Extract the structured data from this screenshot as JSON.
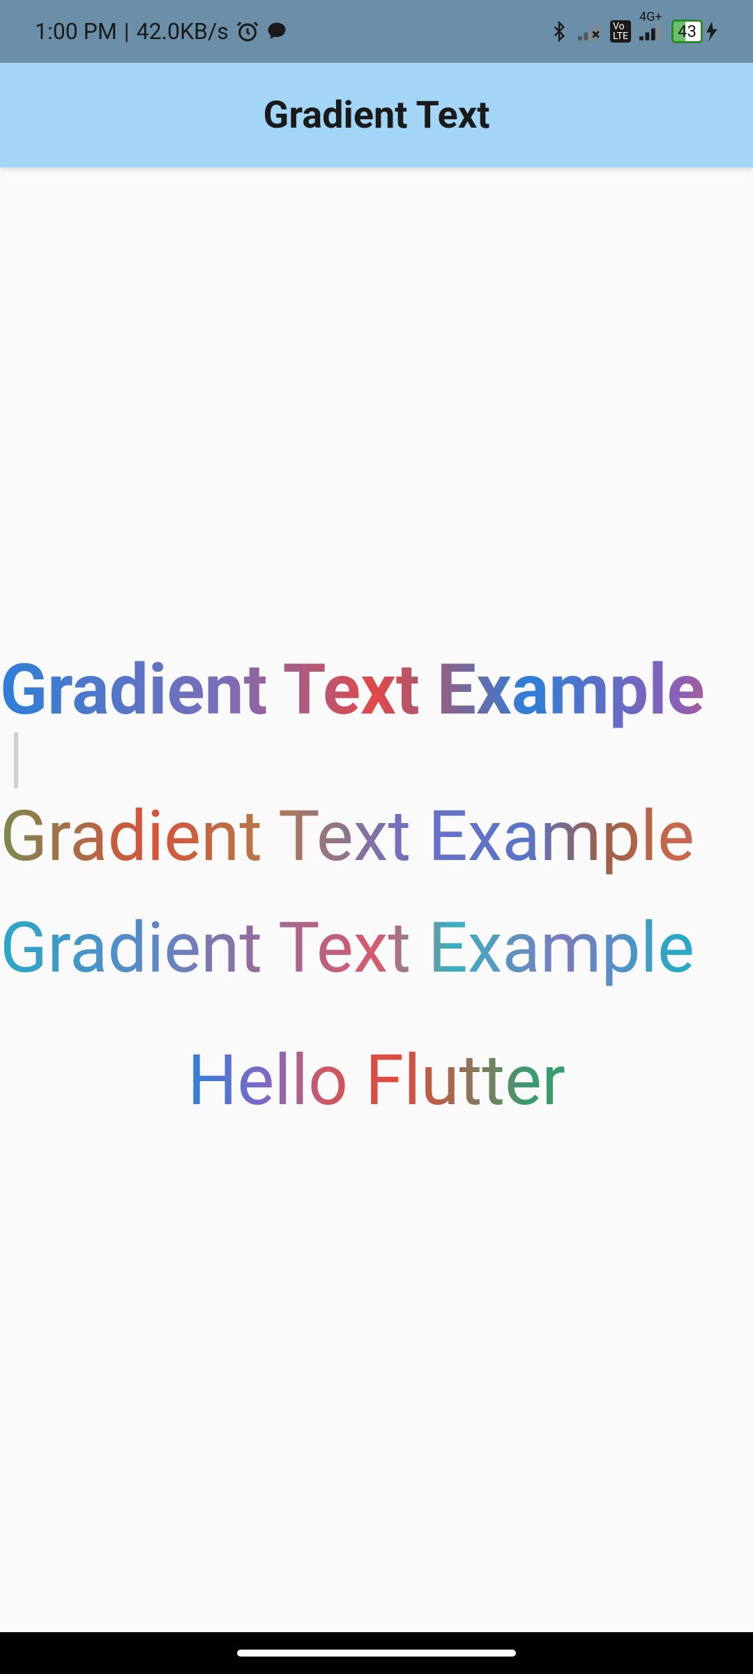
{
  "status": {
    "time": "1:00 PM",
    "speed": "42.0KB/s",
    "network_label": "4G+",
    "battery_pct": "43"
  },
  "appbar": {
    "title": "Gradient Text"
  },
  "content": {
    "text1": "Gradient Text Example",
    "text2": "Gradient Text Example",
    "text3": "Gradient Text Example",
    "text4": "Hello Flutter"
  }
}
